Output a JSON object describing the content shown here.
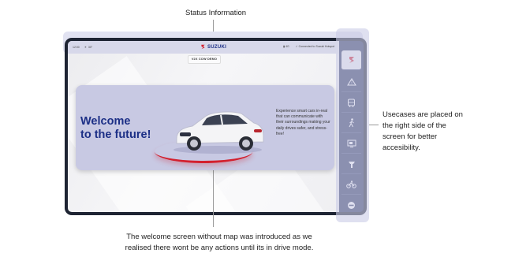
{
  "annotations": {
    "status": "Status Information",
    "usecases_line1": "Usecases are placed on",
    "usecases_line2": "the right side of the",
    "usecases_line3": "screen for better",
    "usecases_line4": "accesibility.",
    "welcome_line1": "The welcome screen without map was introduced as we",
    "welcome_line2": "realised there wont be any actions until its in drive mode."
  },
  "screen": {
    "status_bar": {
      "time": "12:00",
      "weather": "30°",
      "brand": "SUZUKI",
      "network": "4G",
      "connection": "Connected to Suzuki Hotspot"
    },
    "demo_tag": "V2X COW DEMO",
    "hero": {
      "title_line1": "Welcome",
      "title_line2": "to the future!",
      "description": "Experience smart cars in-real that can communicate with their surroundings making your daily drives safer, and stress-free!"
    }
  },
  "sidebar": {
    "items": [
      {
        "icon": "suzuki-logo-icon",
        "active": true
      },
      {
        "icon": "road-icon",
        "active": false
      },
      {
        "icon": "bus-icon",
        "active": false
      },
      {
        "icon": "pedestrian-icon",
        "active": false
      },
      {
        "icon": "display-icon",
        "active": false
      },
      {
        "icon": "traffic-light-icon",
        "active": false
      },
      {
        "icon": "bicycle-icon",
        "active": false
      },
      {
        "icon": "no-entry-icon",
        "active": false
      }
    ]
  },
  "colors": {
    "brand_blue": "#1c2f86",
    "hero_bg": "#c8c9e3",
    "sidebar_bg": "#2f3960",
    "accent_red": "#d3202e",
    "highlight": "#c9cbe6"
  }
}
